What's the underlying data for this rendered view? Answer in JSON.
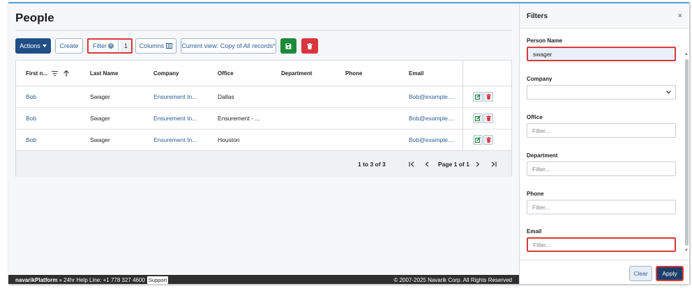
{
  "page": {
    "title": "People"
  },
  "toolbar": {
    "actions_label": "Actions",
    "actions_icon": "caret-down-icon",
    "create_label": "Create",
    "filter_label": "Filter",
    "filter_count": "1",
    "columns_label": "Columns",
    "view_label": "Current view: Copy of All records*",
    "save_icon": "save-icon",
    "delete_icon": "trash-icon"
  },
  "grid": {
    "columns": [
      "First n...",
      "Last Name",
      "Company",
      "Office",
      "Department",
      "Phone",
      "Email"
    ],
    "sort_column": "First n...",
    "sort_direction": "ascending",
    "rows": [
      {
        "first_name": "Bob",
        "last_name": "Swager",
        "company": "Ensurement In...",
        "office": "Dallas",
        "department": "",
        "phone": "",
        "email": "Bob@example...."
      },
      {
        "first_name": "Bob",
        "last_name": "Swager",
        "company": "Ensurement In...",
        "office": "Ensurement - ...",
        "department": "",
        "phone": "",
        "email": "Bob@example...."
      },
      {
        "first_name": "Bob",
        "last_name": "Swager",
        "company": "Ensurement In...",
        "office": "Houston",
        "department": "",
        "phone": "",
        "email": "Bob@example...."
      }
    ],
    "pagination": {
      "range": "1 to 3 of 3",
      "page": "Page 1 of 1"
    }
  },
  "footer": {
    "brand": "navarikPlatform",
    "help": "» 24hr Help Line: +1 778 327 4600",
    "support": "Support",
    "copyright": "© 2007-2025 Navarik Corp. All Rights Reserved"
  },
  "filters": {
    "title": "Filters",
    "close": "×",
    "person_name": {
      "label": "Person Name",
      "value": "swager"
    },
    "company": {
      "label": "Company",
      "value": ""
    },
    "office": {
      "label": "Office",
      "placeholder": "Filter..."
    },
    "department": {
      "label": "Department",
      "placeholder": "Filter..."
    },
    "phone": {
      "label": "Phone",
      "placeholder": "Filter..."
    },
    "email": {
      "label": "Email",
      "placeholder": "Filter..."
    },
    "clear_label": "Clear",
    "apply_label": "Apply"
  },
  "colors": {
    "primary": "#1f4f87",
    "link": "#2a5f96",
    "success": "#1c8a3a",
    "danger": "#d9343f",
    "highlight": "#d83a3a"
  }
}
